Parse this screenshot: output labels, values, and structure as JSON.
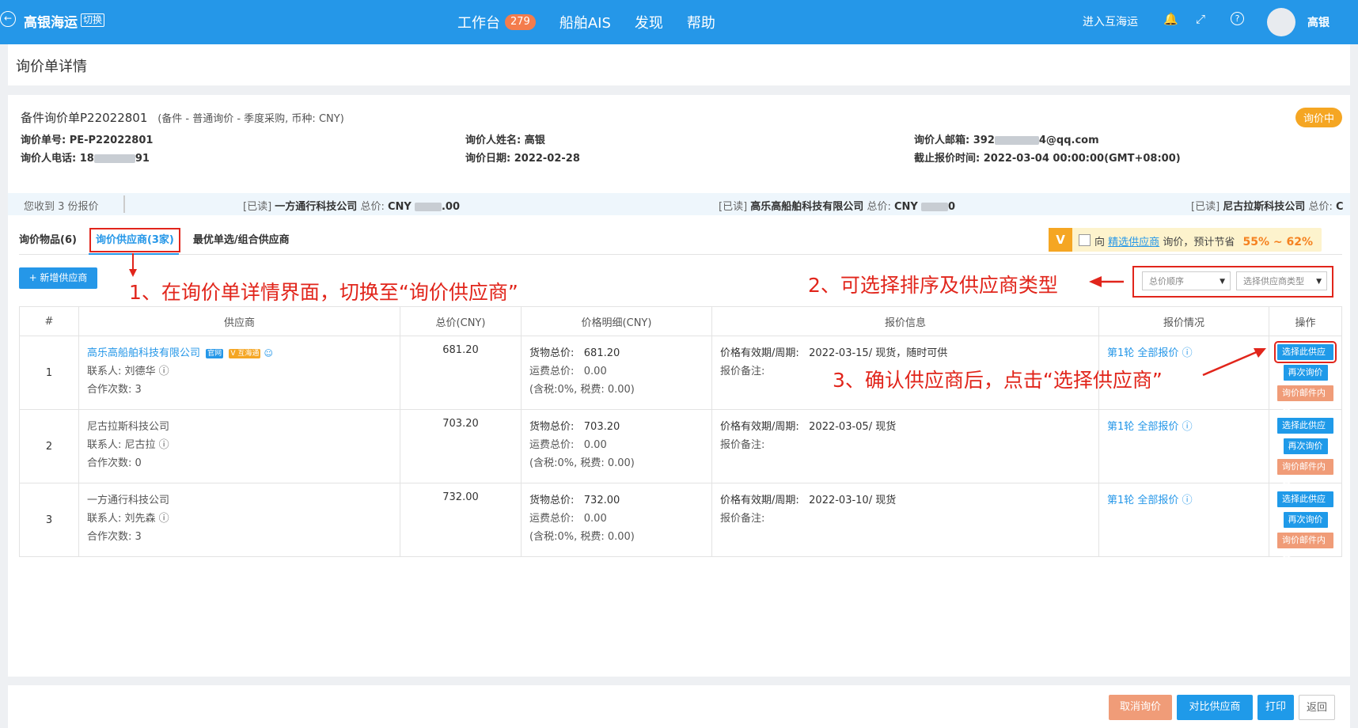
{
  "topbar": {
    "brand": "高银海运",
    "switch": "切换",
    "nav": [
      {
        "label": "工作台",
        "badge": "279"
      },
      {
        "label": "船舶AIS"
      },
      {
        "label": "发现"
      },
      {
        "label": "帮助"
      }
    ],
    "enter_link": "进入互海运",
    "username": "高银"
  },
  "page_title": "询价单详情",
  "header": {
    "title": "备件询价单P22022801",
    "subtitle": "(备件 - 普通询价 - 季度采购, 币种: CNY)",
    "status": "询价中"
  },
  "info": {
    "order_no": "询价单号: PE-P22022801",
    "phone": "询价人电话: 18",
    "phone_tail": "91",
    "name": "询价人姓名: 高银",
    "date": "询价日期: 2022-02-28",
    "email_pre": "询价人邮箱: 392",
    "email_post": "4@qq.com",
    "deadline": "截止报价时间: 2022-03-04 00:00:00(GMT+08:00)"
  },
  "quotes_bar": {
    "received": "您收到 3 份报价",
    "items": [
      {
        "read": "[已读]",
        "company": "一方通行科技公司",
        "label": "总价:",
        "currency": "CNY",
        "tail": ".00"
      },
      {
        "read": "[已读]",
        "company": "高乐高船舶科技有限公司",
        "label": "总价:",
        "currency": "CNY",
        "tail": "0"
      },
      {
        "read": "[已读]",
        "company": "尼古拉斯科技公司",
        "label": "总价:",
        "currency": "C",
        "tail": ""
      }
    ]
  },
  "tabs": [
    "询价物品(6)",
    "询价供应商(3家)",
    "最优单选/组合供应商"
  ],
  "savings": {
    "v": "V",
    "pre": "向",
    "link": "精选供应商",
    "post": "询价，预计节省",
    "pct": "55% ~ 62%"
  },
  "add_button": "+ 新增供应商",
  "annotations": {
    "a1": "1、在询价单详情界面，切换至“询价供应商”",
    "a2": "2、可选择排序及供应商类型",
    "a3": "3、确认供应商后，点击“选择供应商”"
  },
  "filters": {
    "sort": "总价顺序",
    "type": "选择供应商类型"
  },
  "table": {
    "headers": [
      "#",
      "供应商",
      "总价(CNY)",
      "价格明细(CNY)",
      "报价信息",
      "报价情况",
      "操作"
    ],
    "rows": [
      {
        "idx": "1",
        "supplier": "高乐高船舶科技有限公司",
        "contact": "联系人: 刘德华",
        "coop": "合作次数: 3",
        "tag1": "官网",
        "tag2": "V 互海通",
        "total": "681.20",
        "goods": "货物总价:   681.20",
        "freight": "运费总价:   0.00",
        "tax": "(含税:0%, 税费: 0.00)",
        "valid": "价格有效期/周期:   2022-03-15/ 现货，随时可供",
        "remark": "报价备注:",
        "round": "第1轮",
        "all": "全部报价"
      },
      {
        "idx": "2",
        "supplier": "尼古拉斯科技公司",
        "contact": "联系人: 尼古拉",
        "coop": "合作次数: 0",
        "total": "703.20",
        "goods": "货物总价:   703.20",
        "freight": "运费总价:   0.00",
        "tax": "(含税:0%, 税费: 0.00)",
        "valid": "价格有效期/周期:   2022-03-05/ 现货",
        "remark": "报价备注:",
        "round": "第1轮",
        "all": "全部报价"
      },
      {
        "idx": "3",
        "supplier": "一方通行科技公司",
        "contact": "联系人: 刘先森",
        "coop": "合作次数: 3",
        "total": "732.00",
        "goods": "货物总价:   732.00",
        "freight": "运费总价:   0.00",
        "tax": "(含税:0%, 税费: 0.00)",
        "valid": "价格有效期/周期:   2022-03-10/ 现货",
        "remark": "报价备注:",
        "round": "第1轮",
        "all": "全部报价"
      }
    ],
    "ops": {
      "select": "选择此供应商",
      "again": "再次询价",
      "mail": "询价邮件内容"
    }
  },
  "footer": {
    "cancel": "取消询价",
    "compare": "对比供应商",
    "print": "打印",
    "back": "返回"
  },
  "colors": {
    "primary": "#2597e8",
    "accent": "#f5a623",
    "annotation": "#e1251b",
    "soft_orange": "#f09c78"
  }
}
